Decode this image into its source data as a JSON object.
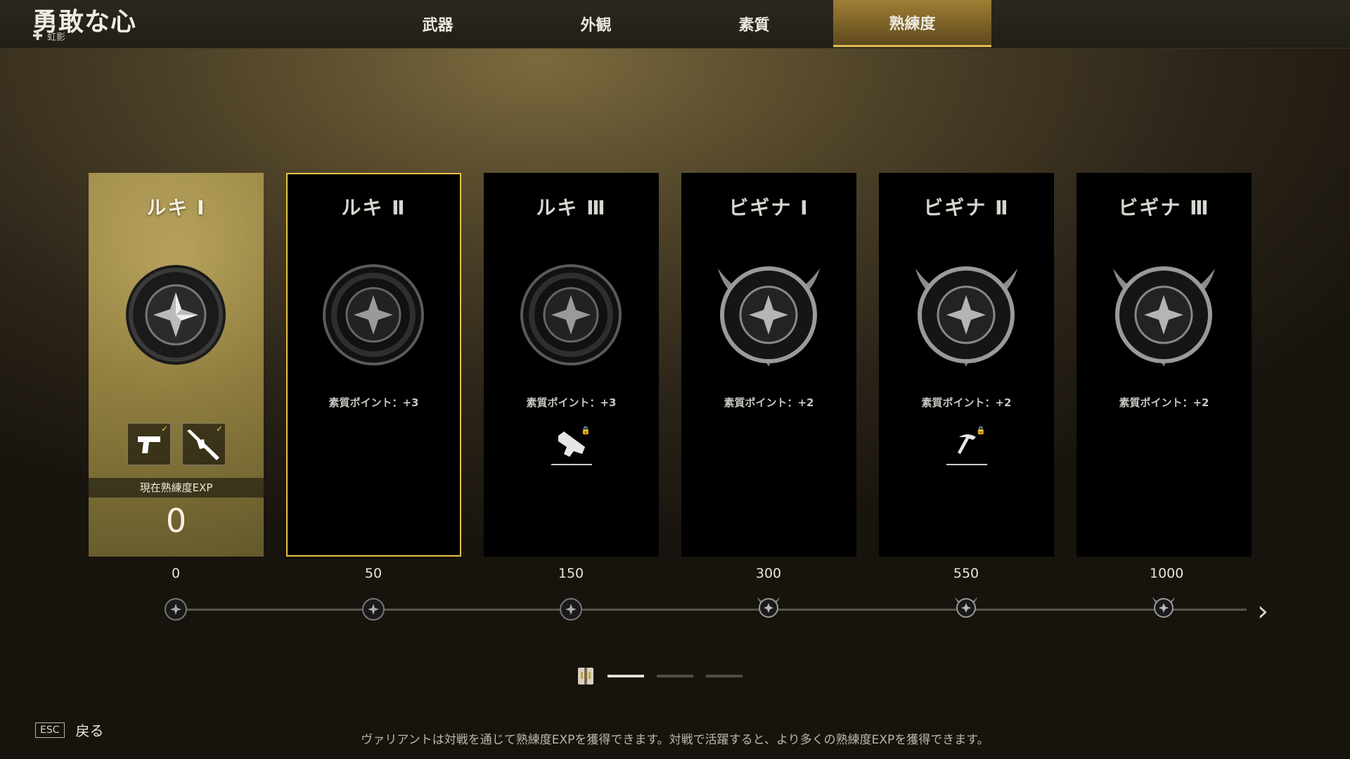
{
  "header": {
    "title": "勇敢な心",
    "faction": "虹影"
  },
  "tabs": [
    {
      "label": "武器",
      "active": false
    },
    {
      "label": "外観",
      "active": false
    },
    {
      "label": "素質",
      "active": false
    },
    {
      "label": "熟練度",
      "active": true
    }
  ],
  "cards": [
    {
      "title": "ルキ Ⅰ",
      "points": "",
      "state": "current",
      "emblem": "ring",
      "unlock": ""
    },
    {
      "title": "ルキ Ⅱ",
      "points": "素質ポイント：+3",
      "state": "selected",
      "emblem": "ring",
      "unlock": ""
    },
    {
      "title": "ルキ Ⅲ",
      "points": "素質ポイント：+3",
      "state": "locked",
      "emblem": "ring",
      "unlock": "smg-icon"
    },
    {
      "title": "ビギナ Ⅰ",
      "points": "素質ポイント：+2",
      "state": "locked",
      "emblem": "horned",
      "unlock": ""
    },
    {
      "title": "ビギナ Ⅱ",
      "points": "素質ポイント：+2",
      "state": "locked",
      "emblem": "horned",
      "unlock": "pickaxe-icon"
    },
    {
      "title": "ビギナ Ⅲ",
      "points": "素質ポイント：+2",
      "state": "locked",
      "emblem": "horned",
      "unlock": ""
    }
  ],
  "current": {
    "exp_label": "現在熟練度EXP",
    "exp_value": "0",
    "weapons": [
      "pistol-icon",
      "shotgun-icon"
    ]
  },
  "progress": {
    "ticks": [
      "0",
      "50",
      "150",
      "300",
      "550",
      "1000"
    ]
  },
  "pager": {
    "pages": 3,
    "active": 0
  },
  "footer": {
    "esc_key": "ESC",
    "esc_label": "戻る",
    "hint": "ヴァリアントは対戦を通じて熟練度EXPを獲得できます。対戦で活躍すると、より多くの熟練度EXPを獲得できます。"
  },
  "colors": {
    "accent": "#e2bd55",
    "tab_active": "#a07e34"
  }
}
